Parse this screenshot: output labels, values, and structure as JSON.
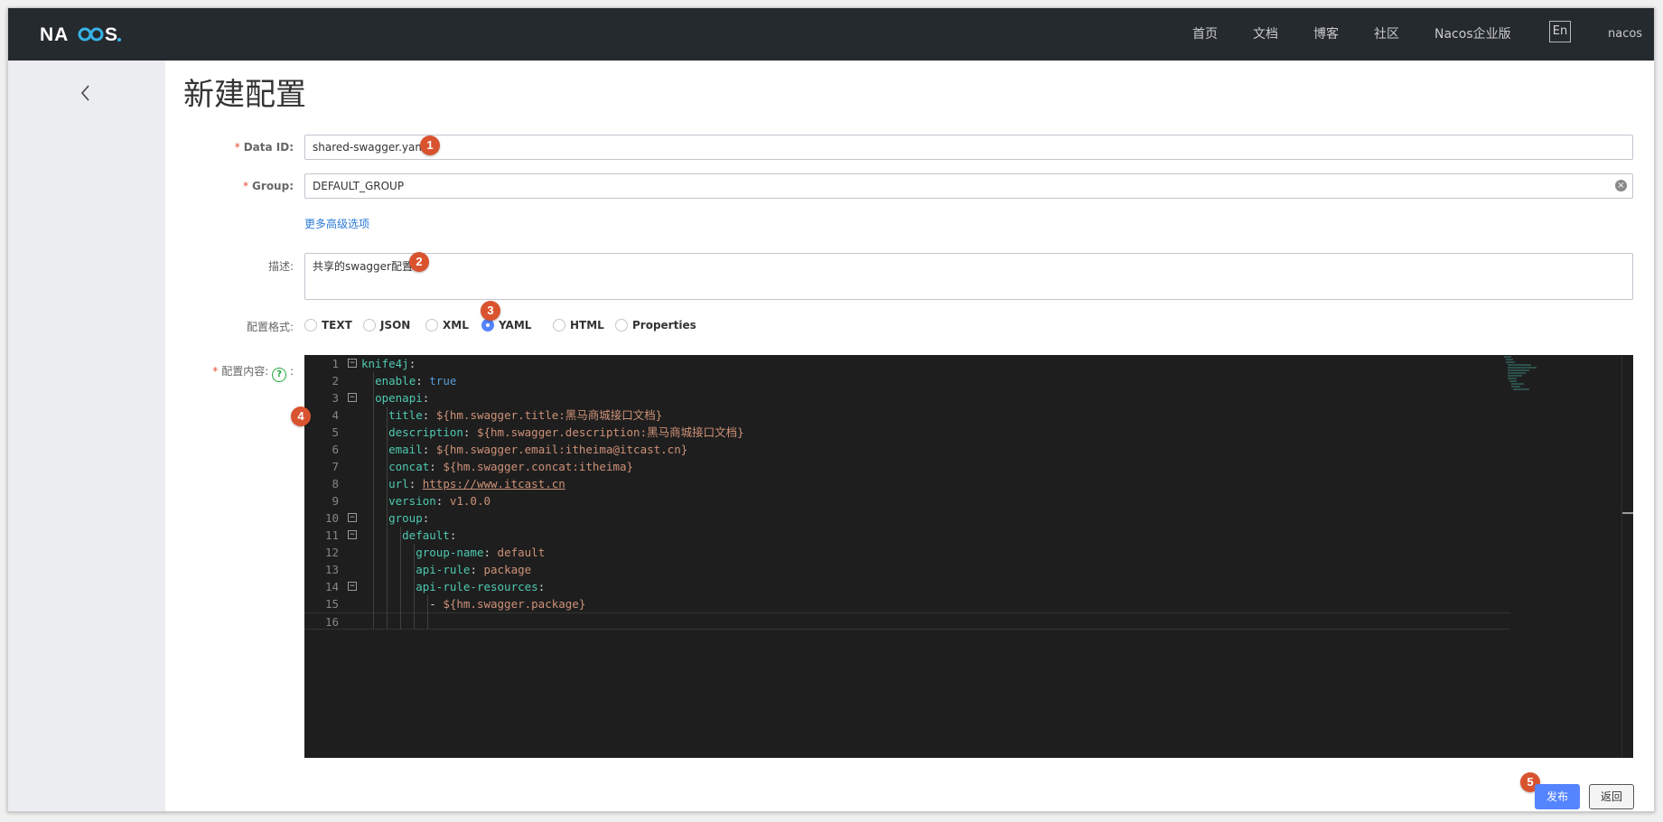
{
  "header": {
    "logo_text": "NACOS.",
    "nav": [
      "首页",
      "文档",
      "博客",
      "社区",
      "Nacos企业版"
    ],
    "lang": "En",
    "user": "nacos"
  },
  "page": {
    "title": "新建配置"
  },
  "form": {
    "data_id": {
      "label": "Data ID:",
      "value": "shared-swagger.yaml"
    },
    "group": {
      "label": "Group:",
      "value": "DEFAULT_GROUP"
    },
    "advanced_link": "更多高级选项",
    "description": {
      "label": "描述:",
      "value": "共享的swagger配置"
    },
    "format": {
      "label": "配置格式:",
      "options": [
        "TEXT",
        "JSON",
        "XML",
        "YAML",
        "HTML",
        "Properties"
      ],
      "selected": "YAML"
    },
    "content_label": "配置内容:",
    "help_symbol": "?",
    "colon": ":"
  },
  "editor": {
    "lines": [
      {
        "n": "1",
        "parts": [
          [
            "k",
            "knife4j"
          ],
          [
            "p",
            ":"
          ]
        ]
      },
      {
        "n": "2",
        "parts": [
          [
            "p",
            "  "
          ],
          [
            "k",
            "enable"
          ],
          [
            "p",
            ": "
          ],
          [
            "b",
            "true"
          ]
        ]
      },
      {
        "n": "3",
        "parts": [
          [
            "p",
            "  "
          ],
          [
            "k",
            "openapi"
          ],
          [
            "p",
            ":"
          ]
        ]
      },
      {
        "n": "4",
        "parts": [
          [
            "p",
            "    "
          ],
          [
            "k",
            "title"
          ],
          [
            "p",
            ": "
          ],
          [
            "v",
            "${hm.swagger.title:黑马商城接口文档}"
          ]
        ]
      },
      {
        "n": "5",
        "parts": [
          [
            "p",
            "    "
          ],
          [
            "k",
            "description"
          ],
          [
            "p",
            ": "
          ],
          [
            "v",
            "${hm.swagger.description:黑马商城接口文档}"
          ]
        ]
      },
      {
        "n": "6",
        "parts": [
          [
            "p",
            "    "
          ],
          [
            "k",
            "email"
          ],
          [
            "p",
            ": "
          ],
          [
            "v",
            "${hm.swagger.email:itheima@itcast.cn}"
          ]
        ]
      },
      {
        "n": "7",
        "parts": [
          [
            "p",
            "    "
          ],
          [
            "k",
            "concat"
          ],
          [
            "p",
            ": "
          ],
          [
            "v",
            "${hm.swagger.concat:itheima}"
          ]
        ]
      },
      {
        "n": "8",
        "parts": [
          [
            "p",
            "    "
          ],
          [
            "k",
            "url"
          ],
          [
            "p",
            ": "
          ],
          [
            "u",
            "https://www.itcast.cn"
          ]
        ]
      },
      {
        "n": "9",
        "parts": [
          [
            "p",
            "    "
          ],
          [
            "k",
            "version"
          ],
          [
            "p",
            ": "
          ],
          [
            "v",
            "v1.0.0"
          ]
        ]
      },
      {
        "n": "10",
        "parts": [
          [
            "p",
            "    "
          ],
          [
            "k",
            "group"
          ],
          [
            "p",
            ":"
          ]
        ]
      },
      {
        "n": "11",
        "parts": [
          [
            "p",
            "      "
          ],
          [
            "k",
            "default"
          ],
          [
            "p",
            ":"
          ]
        ]
      },
      {
        "n": "12",
        "parts": [
          [
            "p",
            "        "
          ],
          [
            "k",
            "group-name"
          ],
          [
            "p",
            ": "
          ],
          [
            "v",
            "default"
          ]
        ]
      },
      {
        "n": "13",
        "parts": [
          [
            "p",
            "        "
          ],
          [
            "k",
            "api-rule"
          ],
          [
            "p",
            ": "
          ],
          [
            "v",
            "package"
          ]
        ]
      },
      {
        "n": "14",
        "parts": [
          [
            "p",
            "        "
          ],
          [
            "k",
            "api-rule-resources"
          ],
          [
            "p",
            ":"
          ]
        ]
      },
      {
        "n": "15",
        "parts": [
          [
            "p",
            "          - "
          ],
          [
            "v",
            "${hm.swagger.package}"
          ]
        ]
      },
      {
        "n": "16",
        "parts": []
      }
    ],
    "foldable_lines": [
      "1",
      "3",
      "10",
      "11",
      "14"
    ]
  },
  "badges": [
    "1",
    "2",
    "3",
    "4",
    "5"
  ],
  "buttons": {
    "publish": "发布",
    "back": "返回"
  },
  "colors": {
    "header_bg": "#252a2f",
    "primary": "#5584ff",
    "badge": "#d9532f",
    "sidebar": "#ecedf0"
  }
}
